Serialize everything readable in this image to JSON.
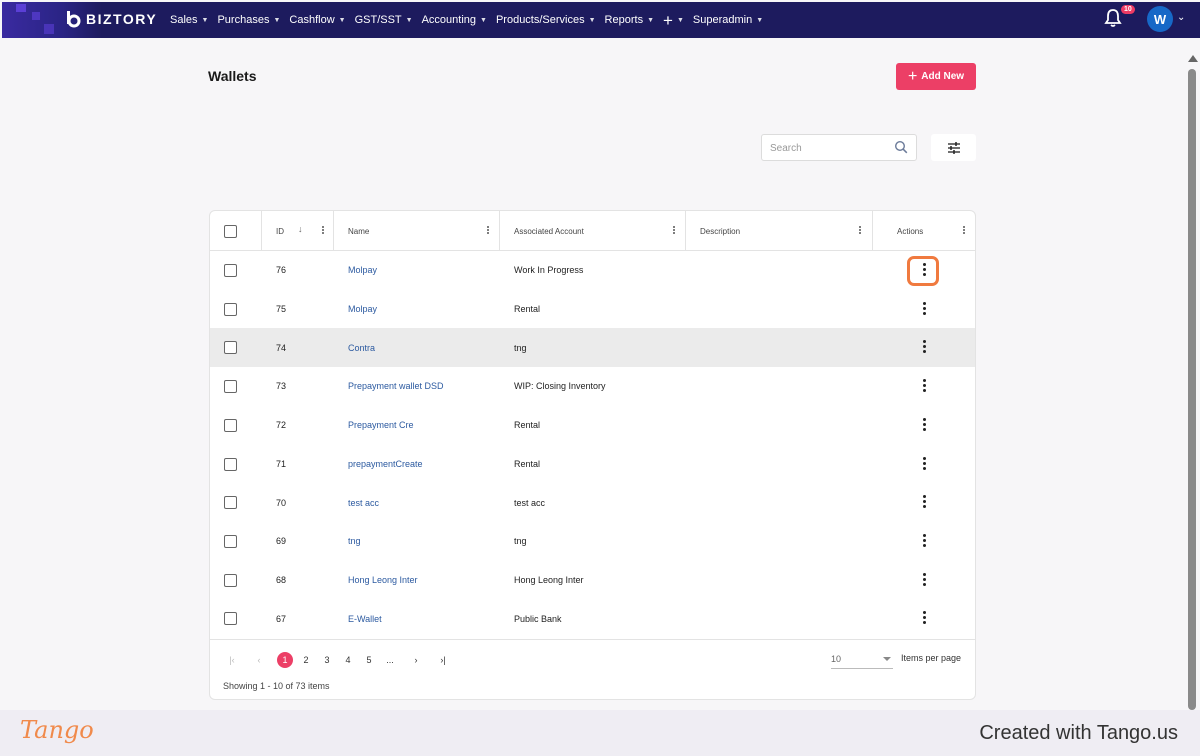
{
  "topbar": {
    "brand": "BIZTORY",
    "nav": [
      {
        "label": "Sales"
      },
      {
        "label": "Purchases"
      },
      {
        "label": "Cashflow"
      },
      {
        "label": "GST/SST"
      },
      {
        "label": "Accounting"
      },
      {
        "label": "Products/Services"
      },
      {
        "label": "Reports"
      },
      {
        "label": "+"
      },
      {
        "label": "Superadmin"
      }
    ],
    "notification_count": "10",
    "avatar_initial": "W"
  },
  "page": {
    "title": "Wallets",
    "add_button": "Add New",
    "search_placeholder": "Search"
  },
  "table": {
    "columns": [
      "ID",
      "Name",
      "Associated Account",
      "Description",
      "Actions"
    ],
    "rows": [
      {
        "id": "76",
        "name": "Molpay",
        "account": "Work In Progress",
        "description": ""
      },
      {
        "id": "75",
        "name": "Molpay",
        "account": "Rental",
        "description": ""
      },
      {
        "id": "74",
        "name": "Contra",
        "account": "tng",
        "description": ""
      },
      {
        "id": "73",
        "name": "Prepayment wallet DSD",
        "account": "WIP: Closing Inventory",
        "description": ""
      },
      {
        "id": "72",
        "name": "Prepayment Cre",
        "account": "Rental",
        "description": ""
      },
      {
        "id": "71",
        "name": "prepaymentCreate",
        "account": "Rental",
        "description": ""
      },
      {
        "id": "70",
        "name": "test acc",
        "account": "test acc",
        "description": ""
      },
      {
        "id": "69",
        "name": "tng",
        "account": "tng",
        "description": ""
      },
      {
        "id": "68",
        "name": "Hong Leong Inter",
        "account": "Hong Leong Inter",
        "description": ""
      },
      {
        "id": "67",
        "name": "E-Wallet",
        "account": "Public Bank",
        "description": ""
      }
    ]
  },
  "pagination": {
    "pages": [
      "1",
      "2",
      "3",
      "4",
      "5",
      "..."
    ],
    "current_page": "1",
    "page_size": "10",
    "page_size_label": "Items per page",
    "summary": "Showing 1 - 10 of 73 items"
  },
  "footer": {
    "logo_text": "Tango",
    "credit": "Created with Tango.us"
  },
  "colors": {
    "nav_bg": "#1d1b5e",
    "accent": "#ec3f66",
    "link": "#2c5aa0",
    "highlight_ring": "#f07a3f"
  }
}
